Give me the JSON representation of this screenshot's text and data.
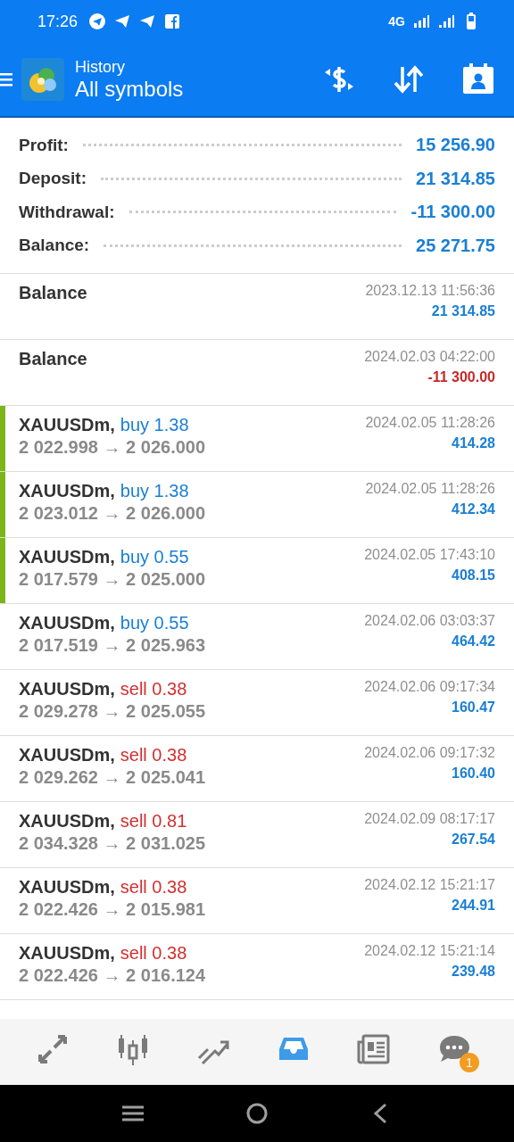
{
  "status_bar": {
    "time": "17:26",
    "network": "4G"
  },
  "header": {
    "subtitle": "History",
    "title": "All symbols"
  },
  "summary": [
    {
      "label": "Profit:",
      "value": "15 256.90"
    },
    {
      "label": "Deposit:",
      "value": "21 314.85"
    },
    {
      "label": "Withdrawal:",
      "value": "-11 300.00"
    },
    {
      "label": "Balance:",
      "value": "25 271.75"
    }
  ],
  "balance_ops": [
    {
      "title": "Balance",
      "time": "2023.12.13 11:56:36",
      "amount": "21 314.85",
      "negative": false
    },
    {
      "title": "Balance",
      "time": "2024.02.03 04:22:00",
      "amount": "-11 300.00",
      "negative": true
    }
  ],
  "deals": [
    {
      "symbol": "XAUUSDm,",
      "kind": "buy",
      "order": "buy 1.38",
      "prices": "2 022.998 → 2 026.000",
      "time": "2024.02.05 11:28:26",
      "profit": "414.28",
      "marked": true
    },
    {
      "symbol": "XAUUSDm,",
      "kind": "buy",
      "order": "buy 1.38",
      "prices": "2 023.012 → 2 026.000",
      "time": "2024.02.05 11:28:26",
      "profit": "412.34",
      "marked": true
    },
    {
      "symbol": "XAUUSDm,",
      "kind": "buy",
      "order": "buy 0.55",
      "prices": "2 017.579 → 2 025.000",
      "time": "2024.02.05 17:43:10",
      "profit": "408.15",
      "marked": true
    },
    {
      "symbol": "XAUUSDm,",
      "kind": "buy",
      "order": "buy 0.55",
      "prices": "2 017.519 → 2 025.963",
      "time": "2024.02.06 03:03:37",
      "profit": "464.42",
      "marked": false
    },
    {
      "symbol": "XAUUSDm,",
      "kind": "sell",
      "order": "sell 0.38",
      "prices": "2 029.278 → 2 025.055",
      "time": "2024.02.06 09:17:34",
      "profit": "160.47",
      "marked": false
    },
    {
      "symbol": "XAUUSDm,",
      "kind": "sell",
      "order": "sell 0.38",
      "prices": "2 029.262 → 2 025.041",
      "time": "2024.02.06 09:17:32",
      "profit": "160.40",
      "marked": false
    },
    {
      "symbol": "XAUUSDm,",
      "kind": "sell",
      "order": "sell 0.81",
      "prices": "2 034.328 → 2 031.025",
      "time": "2024.02.09 08:17:17",
      "profit": "267.54",
      "marked": false
    },
    {
      "symbol": "XAUUSDm,",
      "kind": "sell",
      "order": "sell 0.38",
      "prices": "2 022.426 → 2 015.981",
      "time": "2024.02.12 15:21:17",
      "profit": "244.91",
      "marked": false
    },
    {
      "symbol": "XAUUSDm,",
      "kind": "sell",
      "order": "sell 0.38",
      "prices": "2 022.426 → 2 016.124",
      "time": "2024.02.12 15:21:14",
      "profit": "239.48",
      "marked": false
    }
  ],
  "bottom_nav": [
    {
      "selected": false
    },
    {
      "selected": false
    },
    {
      "selected": false
    },
    {
      "selected": true
    },
    {
      "selected": false
    },
    {
      "selected": false,
      "badge": "1"
    }
  ]
}
